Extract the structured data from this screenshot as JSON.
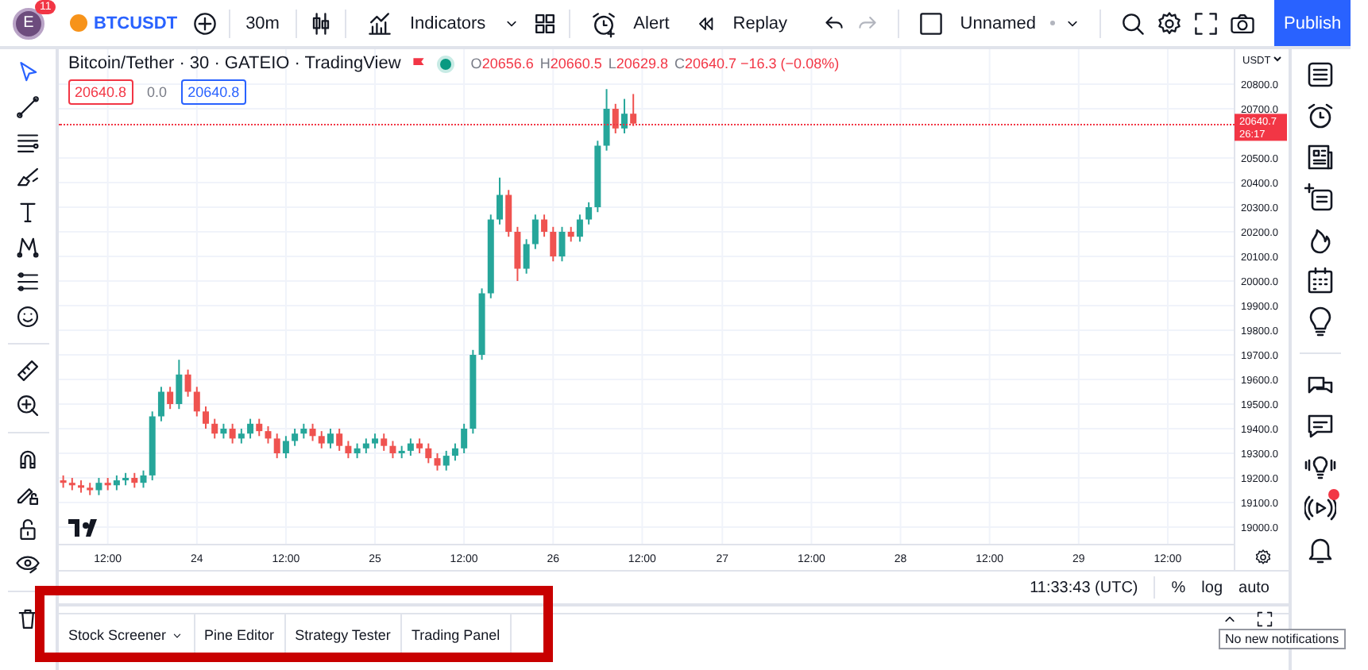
{
  "topbar": {
    "avatar": {
      "letter": "E",
      "badge": "11"
    },
    "symbol": "BTCUSDT",
    "interval": "30m",
    "indicators": "Indicators",
    "alert": "Alert",
    "replay": "Replay",
    "layout_name": "Unnamed",
    "publish": "Publish"
  },
  "chart": {
    "legend": {
      "title": "Bitcoin/Tether · 30 · GATEIO · TradingView",
      "ohlc": [
        {
          "label": "O",
          "value": "20656.6"
        },
        {
          "label": "H",
          "value": "20660.5"
        },
        {
          "label": "L",
          "value": "20629.8"
        },
        {
          "label": "C",
          "value": "20640.7"
        }
      ],
      "change": "−16.3 (−0.08%)"
    },
    "price_boxes": [
      {
        "text": "20640.8",
        "kind": "bid"
      },
      {
        "text": "0.0",
        "kind": "spread"
      },
      {
        "text": "20640.8",
        "kind": "ask"
      }
    ],
    "currency": "USDT",
    "last_price": {
      "price": "20640.7",
      "countdown": "26:17"
    },
    "chart_data": {
      "type": "candlestick",
      "grid": true,
      "ylim": [
        18929,
        20942
      ],
      "categories": [
        null,
        null,
        null,
        null,
        null,
        "12:00",
        null,
        null,
        null,
        null,
        null,
        null,
        null,
        null,
        null,
        "24",
        null,
        null,
        null,
        null,
        null,
        null,
        null,
        null,
        null,
        "12:00",
        null,
        null,
        null,
        null,
        null,
        null,
        null,
        null,
        null,
        "25",
        null,
        null,
        null,
        null,
        null,
        null,
        null,
        null,
        null,
        "12:00",
        null,
        null,
        null,
        null,
        null,
        null,
        null,
        null,
        null,
        "26",
        null,
        null,
        null,
        null,
        null,
        null,
        null,
        null,
        null,
        "12:00",
        null,
        null,
        null,
        null,
        null,
        null,
        null,
        null,
        "27",
        null,
        null,
        null,
        null,
        null,
        null,
        null,
        null,
        null,
        "12:00",
        null,
        null,
        null,
        null,
        null,
        null,
        null,
        null,
        null,
        "28",
        null,
        null,
        null,
        null,
        null,
        null,
        null,
        null,
        null,
        "12:00",
        null,
        null,
        null,
        null,
        null,
        null,
        null,
        null,
        null,
        "29",
        null,
        null,
        null,
        null,
        null,
        null,
        null,
        null,
        null,
        "12:00",
        null,
        null,
        null,
        null,
        null,
        null,
        null
      ],
      "yticks": [
        {
          "value": 20800,
          "label": "20800.0"
        },
        {
          "value": 20700,
          "label": "20700.0"
        },
        {
          "value": 20500,
          "label": "20500.0"
        },
        {
          "value": 20400,
          "label": "20400.0"
        },
        {
          "value": 20300,
          "label": "20300.0"
        },
        {
          "value": 20200,
          "label": "20200.0"
        },
        {
          "value": 20100,
          "label": "20100.0"
        },
        {
          "value": 20000,
          "label": "20000.0"
        },
        {
          "value": 19900,
          "label": "19900.0"
        },
        {
          "value": 19800,
          "label": "19800.0"
        },
        {
          "value": 19700,
          "label": "19700.0"
        },
        {
          "value": 19600,
          "label": "19600.0"
        },
        {
          "value": 19500,
          "label": "19500.0"
        },
        {
          "value": 19400,
          "label": "19400.0"
        },
        {
          "value": 19300,
          "label": "19300.0"
        },
        {
          "value": 19200,
          "label": "19200.0"
        },
        {
          "value": 19100,
          "label": "19100.0"
        },
        {
          "value": 19000,
          "label": "19000.0"
        }
      ],
      "ohlc": [
        [
          19190,
          19210,
          19160,
          19180
        ],
        [
          19180,
          19200,
          19150,
          19170
        ],
        [
          19170,
          19190,
          19140,
          19160
        ],
        [
          19160,
          19180,
          19130,
          19150
        ],
        [
          19150,
          19200,
          19130,
          19180
        ],
        [
          19180,
          19200,
          19150,
          19170
        ],
        [
          19170,
          19210,
          19150,
          19190
        ],
        [
          19190,
          19220,
          19170,
          19200
        ],
        [
          19200,
          19220,
          19160,
          19180
        ],
        [
          19180,
          19230,
          19160,
          19210
        ],
        [
          19210,
          19470,
          19190,
          19450
        ],
        [
          19450,
          19570,
          19430,
          19550
        ],
        [
          19550,
          19570,
          19480,
          19500
        ],
        [
          19500,
          19680,
          19480,
          19620
        ],
        [
          19620,
          19640,
          19530,
          19550
        ],
        [
          19550,
          19570,
          19450,
          19470
        ],
        [
          19470,
          19490,
          19400,
          19420
        ],
        [
          19420,
          19440,
          19360,
          19380
        ],
        [
          19380,
          19420,
          19360,
          19400
        ],
        [
          19400,
          19420,
          19340,
          19360
        ],
        [
          19360,
          19400,
          19340,
          19380
        ],
        [
          19380,
          19440,
          19360,
          19420
        ],
        [
          19420,
          19440,
          19370,
          19390
        ],
        [
          19390,
          19410,
          19340,
          19360
        ],
        [
          19360,
          19380,
          19280,
          19300
        ],
        [
          19300,
          19370,
          19280,
          19350
        ],
        [
          19350,
          19400,
          19330,
          19380
        ],
        [
          19380,
          19420,
          19360,
          19400
        ],
        [
          19400,
          19420,
          19350,
          19370
        ],
        [
          19370,
          19390,
          19320,
          19340
        ],
        [
          19340,
          19400,
          19320,
          19380
        ],
        [
          19380,
          19400,
          19310,
          19330
        ],
        [
          19330,
          19350,
          19280,
          19300
        ],
        [
          19300,
          19340,
          19280,
          19320
        ],
        [
          19320,
          19360,
          19300,
          19340
        ],
        [
          19340,
          19380,
          19320,
          19360
        ],
        [
          19360,
          19380,
          19310,
          19330
        ],
        [
          19330,
          19350,
          19280,
          19300
        ],
        [
          19300,
          19330,
          19280,
          19310
        ],
        [
          19310,
          19360,
          19290,
          19340
        ],
        [
          19340,
          19360,
          19300,
          19320
        ],
        [
          19320,
          19340,
          19260,
          19280
        ],
        [
          19280,
          19300,
          19230,
          19250
        ],
        [
          19250,
          19310,
          19230,
          19290
        ],
        [
          19290,
          19340,
          19270,
          19320
        ],
        [
          19320,
          19420,
          19300,
          19400
        ],
        [
          19400,
          19720,
          19380,
          19700
        ],
        [
          19700,
          19970,
          19680,
          19950
        ],
        [
          19950,
          20270,
          19930,
          20250
        ],
        [
          20250,
          20420,
          20230,
          20350
        ],
        [
          20350,
          20370,
          20180,
          20200
        ],
        [
          20200,
          20220,
          20000,
          20050
        ],
        [
          20050,
          20170,
          20030,
          20150
        ],
        [
          20150,
          20270,
          20130,
          20250
        ],
        [
          20250,
          20270,
          20180,
          20200
        ],
        [
          20200,
          20220,
          20080,
          20100
        ],
        [
          20100,
          20220,
          20080,
          20200
        ],
        [
          20200,
          20220,
          20160,
          20180
        ],
        [
          20180,
          20270,
          20160,
          20250
        ],
        [
          20250,
          20320,
          20230,
          20300
        ],
        [
          20300,
          20570,
          20280,
          20550
        ],
        [
          20550,
          20780,
          20530,
          20700
        ],
        [
          20700,
          20720,
          20600,
          20620
        ],
        [
          20620,
          20740,
          20600,
          20680
        ],
        [
          20680,
          20760,
          20630,
          20640
        ],
        null,
        null,
        null,
        null,
        null,
        null,
        null,
        null,
        null,
        null,
        null,
        null,
        null,
        null,
        null,
        null,
        null,
        null,
        null,
        null,
        null,
        null,
        null,
        null,
        null,
        null,
        null,
        null,
        null,
        null,
        null,
        null,
        null,
        null,
        null,
        null,
        null,
        null,
        null,
        null,
        null,
        null,
        null,
        null,
        null,
        null,
        null,
        null,
        null,
        null,
        null,
        null,
        null,
        null,
        null,
        null,
        null,
        null,
        null,
        null,
        null,
        null,
        null,
        null,
        null,
        null,
        null
      ]
    }
  },
  "status_bar": {
    "time": "11:33:43 (UTC)",
    "options": [
      "%",
      "log",
      "auto"
    ]
  },
  "bottom_tabs": [
    {
      "label": "Stock Screener",
      "dropdown": true
    },
    {
      "label": "Pine Editor",
      "dropdown": false
    },
    {
      "label": "Strategy Tester",
      "dropdown": false
    },
    {
      "label": "Trading Panel",
      "dropdown": false
    }
  ],
  "tooltip": "No new notifications"
}
